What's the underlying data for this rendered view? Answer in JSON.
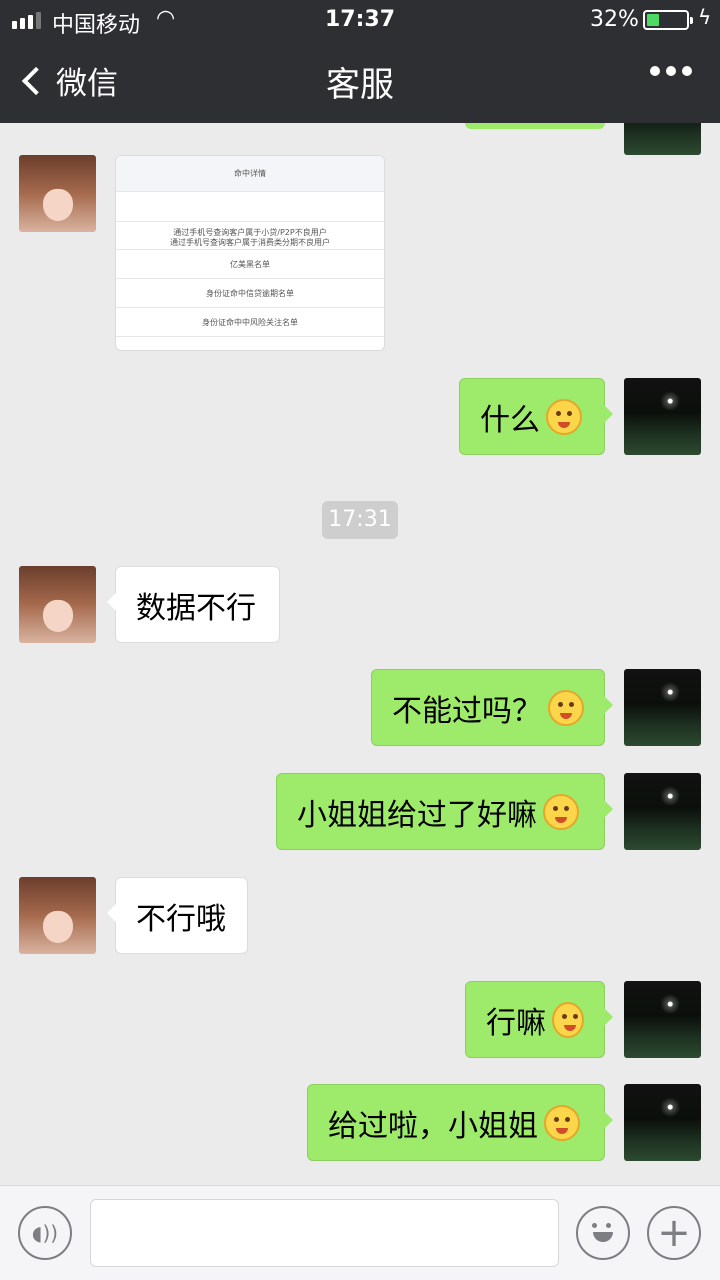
{
  "status_bar": {
    "carrier": "中国移动",
    "time": "17:37",
    "battery_percent": "32%",
    "battery_level": 0.32,
    "signal_bars": 3
  },
  "nav": {
    "back_label": "微信",
    "title": "客服"
  },
  "image_card": {
    "header": "命中详情",
    "rows": [
      "通过手机号查询客户属于小贷/P2P不良用户",
      "通过手机号查询客户属于消费类分期不良用户",
      "亿美黑名单",
      "身份证命中信贷逾期名单",
      "身份证命中中风险关注名单"
    ]
  },
  "messages": {
    "m1": "什么",
    "timestamp": "17:31",
    "m2": "数据不行",
    "m3": "不能过吗？",
    "m4": "小姐姐给过了好嘛",
    "m5": "不行哦",
    "m6": "行嘛",
    "m7": "给过啦，小姐姐"
  },
  "colors": {
    "nav_bg": "#2e2f33",
    "chat_bg": "#ebebeb",
    "outgoing_bubble": "#9eea6a",
    "incoming_bubble": "#ffffff"
  }
}
